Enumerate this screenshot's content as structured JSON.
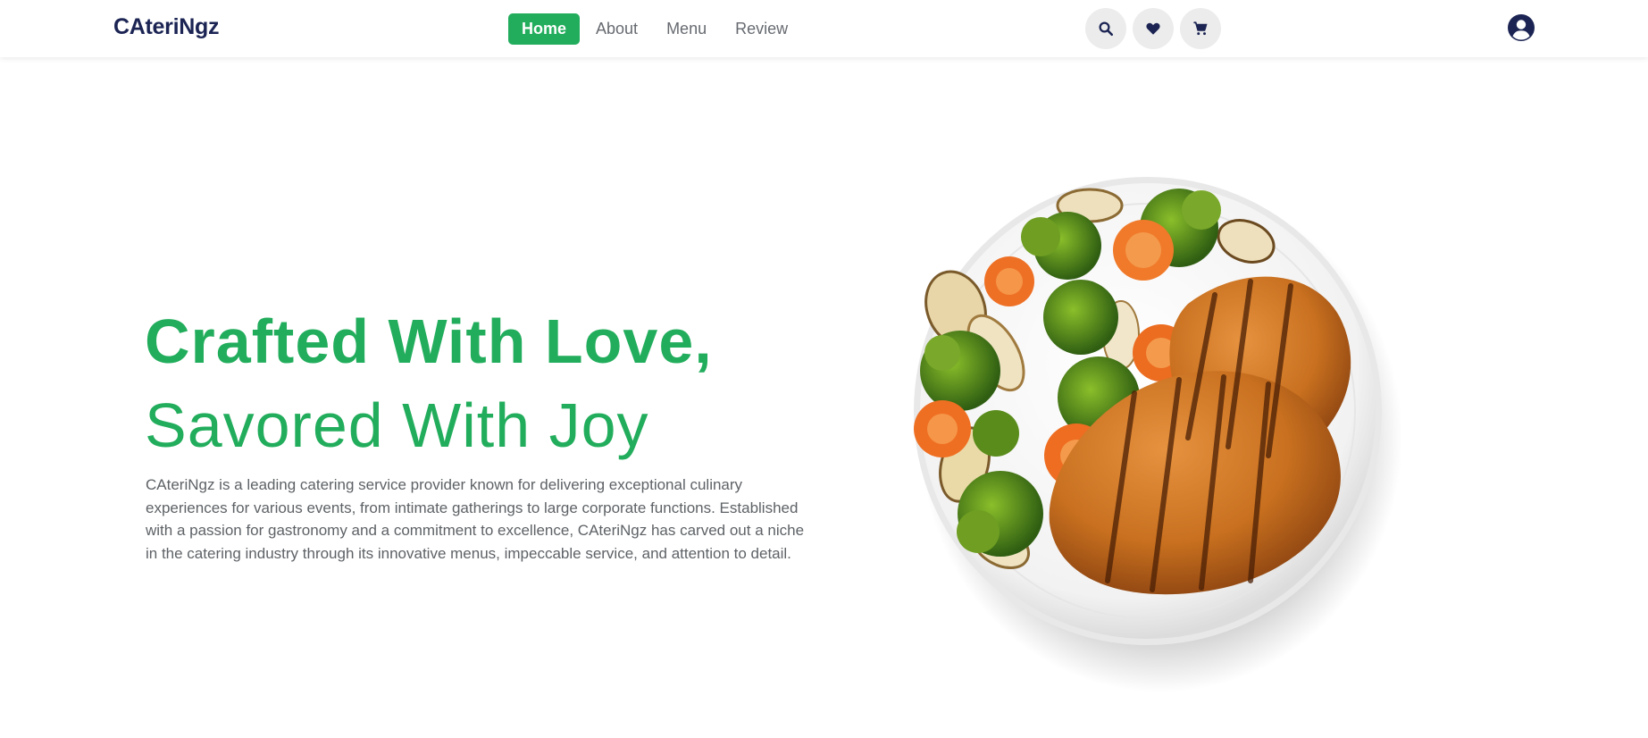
{
  "header": {
    "brand": "CAteriNgz",
    "nav": [
      {
        "label": "Home",
        "active": true
      },
      {
        "label": "About",
        "active": false
      },
      {
        "label": "Menu",
        "active": false
      },
      {
        "label": "Review",
        "active": false
      }
    ],
    "icons": [
      "search-icon",
      "heart-icon",
      "cart-icon"
    ],
    "profile_icon": "user-circle-icon"
  },
  "hero": {
    "title_line1": "Crafted With Love,",
    "title_line2": "Savored With Joy",
    "description": "CAteriNgz is a leading catering service provider known for delivering exceptional culinary experiences for various events, from intimate gatherings to large corporate functions. Established with a passion for gastronomy and a commitment to excellence, CAteriNgz has carved out a niche in the catering industry through its innovative menus, impeccable service, and attention to detail.",
    "image": "grilled-chicken-vegetable-plate"
  },
  "colors": {
    "accent": "#22ad5c",
    "brand": "#1b2453",
    "text": "#5e6266",
    "icon_bg": "#ececec"
  }
}
